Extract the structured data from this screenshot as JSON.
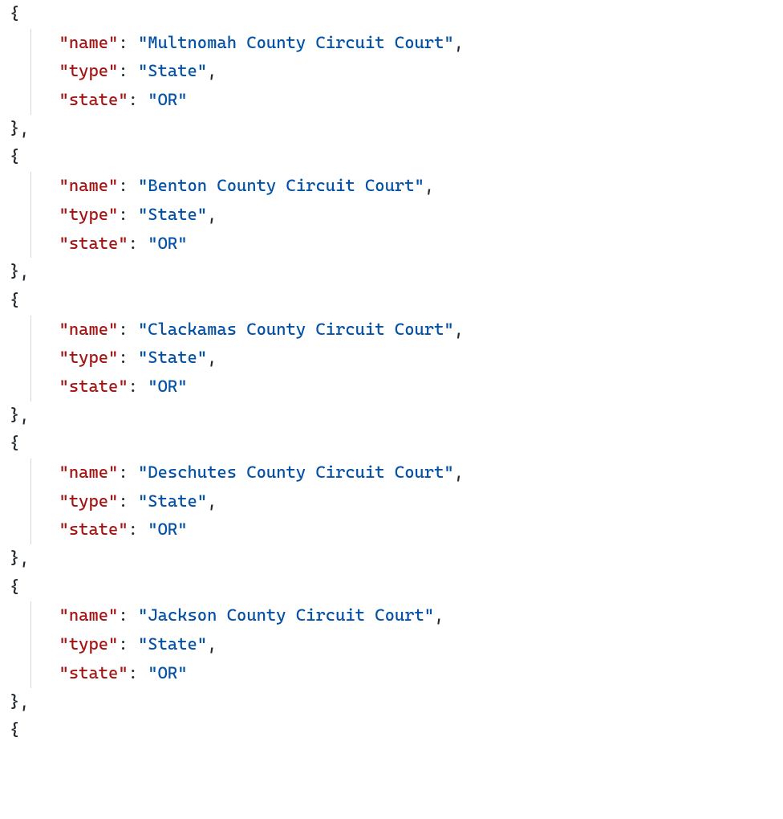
{
  "objects": [
    {
      "fields": [
        {
          "key": "name",
          "value": "Multnomah County Circuit Court"
        },
        {
          "key": "type",
          "value": "State"
        },
        {
          "key": "state",
          "value": "OR"
        }
      ]
    },
    {
      "fields": [
        {
          "key": "name",
          "value": "Benton County Circuit Court"
        },
        {
          "key": "type",
          "value": "State"
        },
        {
          "key": "state",
          "value": "OR"
        }
      ]
    },
    {
      "fields": [
        {
          "key": "name",
          "value": "Clackamas County Circuit Court"
        },
        {
          "key": "type",
          "value": "State"
        },
        {
          "key": "state",
          "value": "OR"
        }
      ]
    },
    {
      "fields": [
        {
          "key": "name",
          "value": "Deschutes County Circuit Court"
        },
        {
          "key": "type",
          "value": "State"
        },
        {
          "key": "state",
          "value": "OR"
        }
      ]
    },
    {
      "fields": [
        {
          "key": "name",
          "value": "Jackson County Circuit Court"
        },
        {
          "key": "type",
          "value": "State"
        },
        {
          "key": "state",
          "value": "OR"
        }
      ]
    }
  ],
  "punct": {
    "open_brace": "{",
    "close_brace": "}",
    "close_brace_comma": "},",
    "quote": "\"",
    "colon_space": ": ",
    "comma": ","
  },
  "indent": {
    "level1": "     "
  }
}
